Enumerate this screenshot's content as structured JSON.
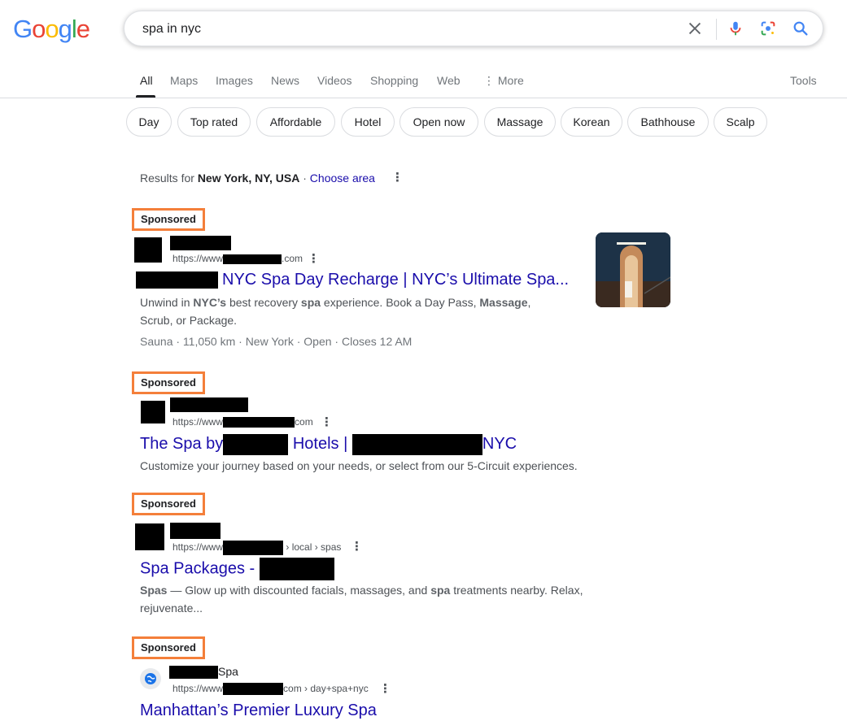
{
  "logo": {
    "letters": [
      "G",
      "o",
      "o",
      "g",
      "l",
      "e"
    ],
    "colors": [
      "#4285F4",
      "#EA4335",
      "#FBBC05",
      "#4285F4",
      "#34A853",
      "#EA4335"
    ]
  },
  "search": {
    "query": "spa in nyc"
  },
  "tabs": [
    "All",
    "Maps",
    "Images",
    "News",
    "Videos",
    "Shopping",
    "Web",
    "More"
  ],
  "tools_label": "Tools",
  "chips": [
    "Day",
    "Top rated",
    "Affordable",
    "Hotel",
    "Open now",
    "Massage",
    "Korean",
    "Bathhouse",
    "Scalp"
  ],
  "results_for": {
    "prefix": "Results for",
    "location": "New York, NY, USA",
    "separator": "·",
    "choose": "Choose area"
  },
  "ads": [
    {
      "sponsored": "Sponsored",
      "url_prefix": "https://www",
      "url_suffix": ".com",
      "title": "NYC Spa Day Recharge | NYC’s Ultimate Spa...",
      "desc": [
        "Unwind in ",
        "NYC’s",
        " best recovery ",
        "spa",
        " experience. Book a Day Pass, ",
        "Massage",
        ",",
        "Scrub, or Package."
      ],
      "meta": "Sauna · 11,050 km · New York · Open · Closes 12 AM"
    },
    {
      "sponsored": "Sponsored",
      "url_prefix": "https://www",
      "url_suffix": "com",
      "title_parts": [
        "The Spa by",
        "Hotels |",
        "NYC"
      ],
      "desc": "Customize your journey based on your needs, or select from our 5-Circuit experiences."
    },
    {
      "sponsored": "Sponsored",
      "url_prefix": "https://www",
      "url_suffix": "› local › spas",
      "title": "Spa Packages -",
      "desc": [
        "Spas",
        " — Glow up with discounted facials, massages, and ",
        "spa",
        " treatments nearby. Relax,",
        "rejuvenate..."
      ]
    },
    {
      "sponsored": "Sponsored",
      "site_suffix": "Spa",
      "url_prefix": "https://www",
      "url_suffix": "com › day+spa+nyc",
      "title": "Manhattan’s Premier Luxury Spa"
    }
  ]
}
